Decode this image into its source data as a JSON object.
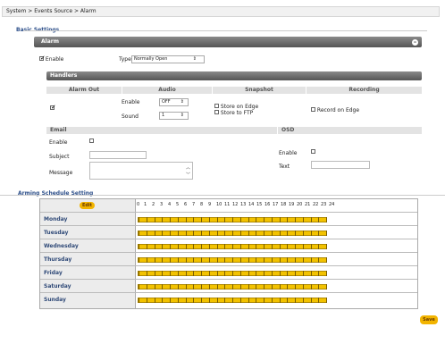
{
  "breadcrumb": "System > Events Source > Alarm",
  "basic_settings": {
    "title": "Basic Settings",
    "alarm_bar": "Alarm",
    "collapse_icon": "minus-circle-icon",
    "enable_label": "Enable",
    "enable_checked": true,
    "type_label": "Type",
    "type_value": "Normally Open"
  },
  "handlers": {
    "title": "Handlers",
    "headers": [
      "Alarm Out",
      "Audio",
      "Snapshot",
      "Recording"
    ],
    "alarm_out_checked": true,
    "audio": {
      "enable_label": "Enable",
      "enable_value": "OFF",
      "sound_label": "Sound",
      "sound_value": "1"
    },
    "snapshot": {
      "store_edge": "Store on Edge",
      "store_ftp": "Store to FTP"
    },
    "recording": {
      "record_edge": "Record on Edge"
    },
    "email": {
      "title": "Email",
      "enable_label": "Enable",
      "subject_label": "Subject",
      "message_label": "Message"
    },
    "osd": {
      "title": "OSD",
      "enable_label": "Enable",
      "text_label": "Text"
    }
  },
  "schedule": {
    "title": "Arming Schedule Setting",
    "edit_label": "Edit",
    "hours": [
      "0",
      "1",
      "2",
      "3",
      "4",
      "5",
      "6",
      "7",
      "8",
      "9",
      "10",
      "11",
      "12",
      "13",
      "14",
      "15",
      "16",
      "17",
      "18",
      "19",
      "20",
      "21",
      "22",
      "23",
      "24"
    ],
    "days": [
      "Monday",
      "Tuesday",
      "Wednesday",
      "Thursday",
      "Friday",
      "Saturday",
      "Sunday"
    ]
  },
  "save_label": "Save",
  "colors": {
    "accent_yellow": "#f2b400",
    "title_blue": "#2d4f8a"
  }
}
